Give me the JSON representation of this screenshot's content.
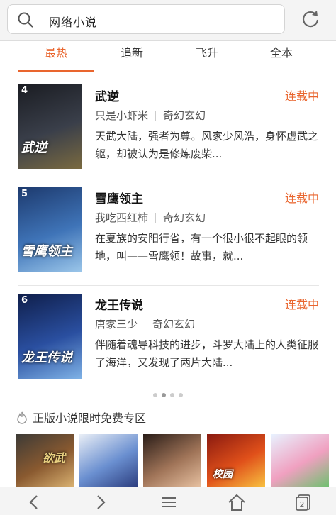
{
  "search": {
    "text": "网络小说"
  },
  "tabs": [
    {
      "label": "最热",
      "active": true
    },
    {
      "label": "追新"
    },
    {
      "label": "飞升"
    },
    {
      "label": "全本"
    }
  ],
  "books": [
    {
      "rank": "4",
      "title": "武逆",
      "status": "连载中",
      "author": "只是小虾米",
      "genre": "奇幻玄幻",
      "desc": "天武大陆，强者为尊。风家少风浩，身怀虚武之躯，却被认为是修炼废柴...",
      "cover_text": "武逆",
      "cover_colors": [
        "#1a1c22",
        "#3a3f4a",
        "#7a6a40"
      ]
    },
    {
      "rank": "5",
      "title": "雪鹰领主",
      "status": "连载中",
      "author": "我吃西红柿",
      "genre": "奇幻玄幻",
      "desc": "在夏族的安阳行省，有一个很小很不起眼的领地，叫——雪鹰领！故事，就...",
      "cover_text": "雪鹰领主",
      "cover_colors": [
        "#1d3a6e",
        "#3f74b8",
        "#9cc7ea"
      ]
    },
    {
      "rank": "6",
      "title": "龙王传说",
      "status": "连载中",
      "author": "唐家三少",
      "genre": "奇幻玄幻",
      "desc": "伴随着魂导科技的进步，斗罗大陆上的人类征服了海洋，又发现了两片大陆...",
      "cover_text": "龙王传说",
      "cover_colors": [
        "#0f1e4a",
        "#2a4fa0",
        "#7fb2e6"
      ]
    }
  ],
  "carousel": {
    "count": 4,
    "active": 1
  },
  "zone": {
    "title": "正版小说限时免费专区",
    "thumbs": [
      {
        "label": "欲武",
        "colors": [
          "#3c3a36",
          "#8a5a30",
          "#d8b070"
        ]
      },
      {
        "label": "",
        "colors": [
          "#e9eef6",
          "#6a8fd0",
          "#2d3f80"
        ]
      },
      {
        "label": "",
        "colors": [
          "#2a1d18",
          "#a07458",
          "#e6c0a0"
        ]
      },
      {
        "label": "校园",
        "colors": [
          "#8a1a10",
          "#e0501a",
          "#f8c040"
        ]
      },
      {
        "label": "",
        "colors": [
          "#e8f2ff",
          "#f0a0c0",
          "#70c070"
        ]
      }
    ]
  }
}
